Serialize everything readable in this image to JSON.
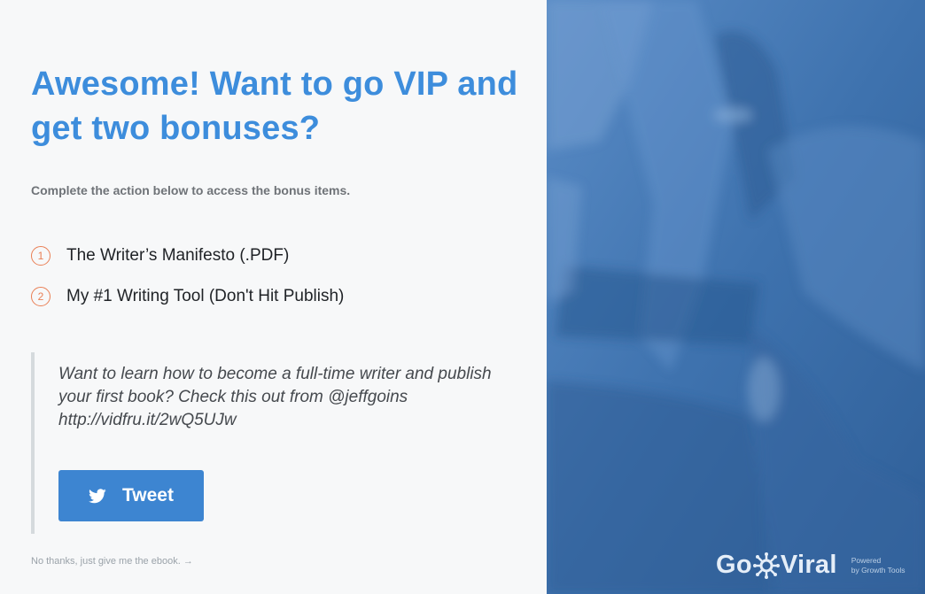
{
  "headline": "Awesome! Want to go VIP and get two bonuses?",
  "subtitle": "Complete the action below to access the bonus items.",
  "bonuses": [
    {
      "number": "1",
      "label": "The Writer’s Manifesto (.PDF)"
    },
    {
      "number": "2",
      "label": "My #1 Writing Tool (Don't Hit Publish)"
    }
  ],
  "tweet": {
    "text": "Want to learn how to become a full-time writer and publish your first book? Check this out from @jeffgoins http://vidfru.it/2wQ5UJw",
    "button_label": "Tweet",
    "button_icon": "twitter-bird-icon"
  },
  "decline_link": "No thanks, just give me the ebook. →",
  "brand": {
    "logo_part1": "Go",
    "logo_part2": "Viral",
    "powered_line1": "Powered",
    "powered_line2": "by Growth Tools"
  },
  "colors": {
    "accent_blue": "#3d8ddc",
    "button_blue": "#3d85d1",
    "number_orange": "#e97f55",
    "photo_tint": "#3f72ad"
  }
}
